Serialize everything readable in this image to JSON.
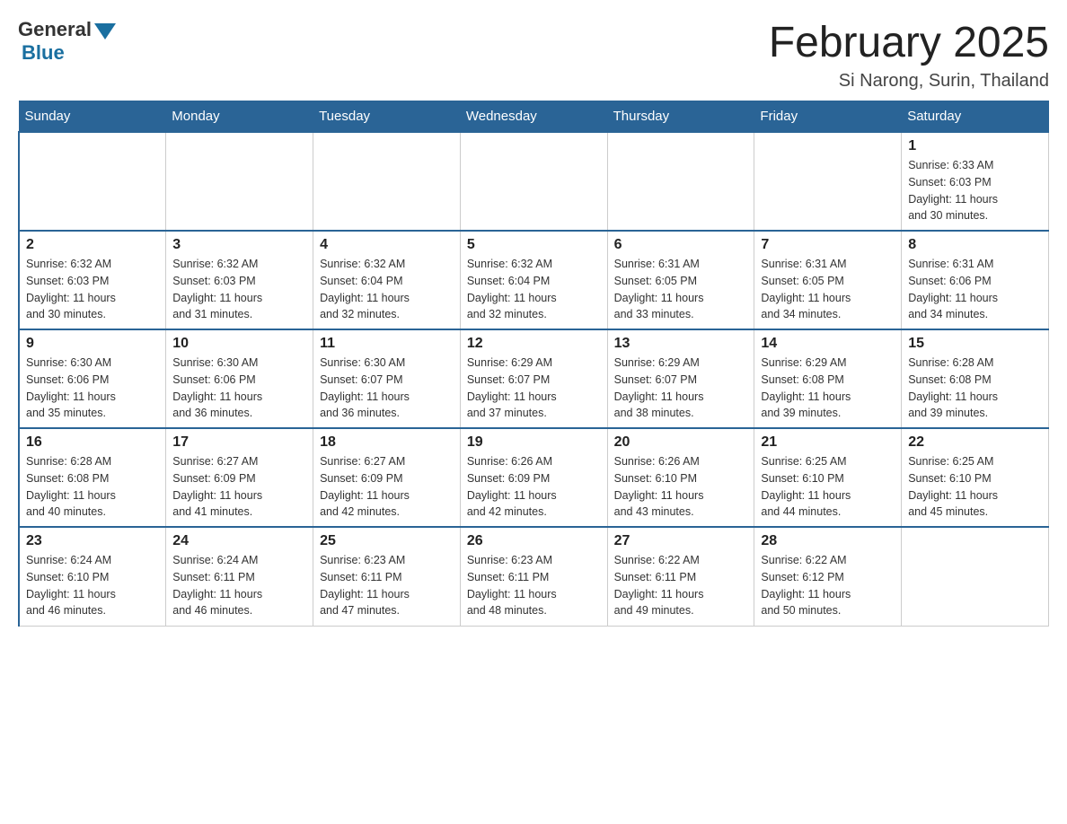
{
  "header": {
    "logo_general": "General",
    "logo_blue": "Blue",
    "month_title": "February 2025",
    "location": "Si Narong, Surin, Thailand"
  },
  "days_of_week": [
    "Sunday",
    "Monday",
    "Tuesday",
    "Wednesday",
    "Thursday",
    "Friday",
    "Saturday"
  ],
  "weeks": [
    [
      {
        "day": "",
        "info": ""
      },
      {
        "day": "",
        "info": ""
      },
      {
        "day": "",
        "info": ""
      },
      {
        "day": "",
        "info": ""
      },
      {
        "day": "",
        "info": ""
      },
      {
        "day": "",
        "info": ""
      },
      {
        "day": "1",
        "info": "Sunrise: 6:33 AM\nSunset: 6:03 PM\nDaylight: 11 hours\nand 30 minutes."
      }
    ],
    [
      {
        "day": "2",
        "info": "Sunrise: 6:32 AM\nSunset: 6:03 PM\nDaylight: 11 hours\nand 30 minutes."
      },
      {
        "day": "3",
        "info": "Sunrise: 6:32 AM\nSunset: 6:03 PM\nDaylight: 11 hours\nand 31 minutes."
      },
      {
        "day": "4",
        "info": "Sunrise: 6:32 AM\nSunset: 6:04 PM\nDaylight: 11 hours\nand 32 minutes."
      },
      {
        "day": "5",
        "info": "Sunrise: 6:32 AM\nSunset: 6:04 PM\nDaylight: 11 hours\nand 32 minutes."
      },
      {
        "day": "6",
        "info": "Sunrise: 6:31 AM\nSunset: 6:05 PM\nDaylight: 11 hours\nand 33 minutes."
      },
      {
        "day": "7",
        "info": "Sunrise: 6:31 AM\nSunset: 6:05 PM\nDaylight: 11 hours\nand 34 minutes."
      },
      {
        "day": "8",
        "info": "Sunrise: 6:31 AM\nSunset: 6:06 PM\nDaylight: 11 hours\nand 34 minutes."
      }
    ],
    [
      {
        "day": "9",
        "info": "Sunrise: 6:30 AM\nSunset: 6:06 PM\nDaylight: 11 hours\nand 35 minutes."
      },
      {
        "day": "10",
        "info": "Sunrise: 6:30 AM\nSunset: 6:06 PM\nDaylight: 11 hours\nand 36 minutes."
      },
      {
        "day": "11",
        "info": "Sunrise: 6:30 AM\nSunset: 6:07 PM\nDaylight: 11 hours\nand 36 minutes."
      },
      {
        "day": "12",
        "info": "Sunrise: 6:29 AM\nSunset: 6:07 PM\nDaylight: 11 hours\nand 37 minutes."
      },
      {
        "day": "13",
        "info": "Sunrise: 6:29 AM\nSunset: 6:07 PM\nDaylight: 11 hours\nand 38 minutes."
      },
      {
        "day": "14",
        "info": "Sunrise: 6:29 AM\nSunset: 6:08 PM\nDaylight: 11 hours\nand 39 minutes."
      },
      {
        "day": "15",
        "info": "Sunrise: 6:28 AM\nSunset: 6:08 PM\nDaylight: 11 hours\nand 39 minutes."
      }
    ],
    [
      {
        "day": "16",
        "info": "Sunrise: 6:28 AM\nSunset: 6:08 PM\nDaylight: 11 hours\nand 40 minutes."
      },
      {
        "day": "17",
        "info": "Sunrise: 6:27 AM\nSunset: 6:09 PM\nDaylight: 11 hours\nand 41 minutes."
      },
      {
        "day": "18",
        "info": "Sunrise: 6:27 AM\nSunset: 6:09 PM\nDaylight: 11 hours\nand 42 minutes."
      },
      {
        "day": "19",
        "info": "Sunrise: 6:26 AM\nSunset: 6:09 PM\nDaylight: 11 hours\nand 42 minutes."
      },
      {
        "day": "20",
        "info": "Sunrise: 6:26 AM\nSunset: 6:10 PM\nDaylight: 11 hours\nand 43 minutes."
      },
      {
        "day": "21",
        "info": "Sunrise: 6:25 AM\nSunset: 6:10 PM\nDaylight: 11 hours\nand 44 minutes."
      },
      {
        "day": "22",
        "info": "Sunrise: 6:25 AM\nSunset: 6:10 PM\nDaylight: 11 hours\nand 45 minutes."
      }
    ],
    [
      {
        "day": "23",
        "info": "Sunrise: 6:24 AM\nSunset: 6:10 PM\nDaylight: 11 hours\nand 46 minutes."
      },
      {
        "day": "24",
        "info": "Sunrise: 6:24 AM\nSunset: 6:11 PM\nDaylight: 11 hours\nand 46 minutes."
      },
      {
        "day": "25",
        "info": "Sunrise: 6:23 AM\nSunset: 6:11 PM\nDaylight: 11 hours\nand 47 minutes."
      },
      {
        "day": "26",
        "info": "Sunrise: 6:23 AM\nSunset: 6:11 PM\nDaylight: 11 hours\nand 48 minutes."
      },
      {
        "day": "27",
        "info": "Sunrise: 6:22 AM\nSunset: 6:11 PM\nDaylight: 11 hours\nand 49 minutes."
      },
      {
        "day": "28",
        "info": "Sunrise: 6:22 AM\nSunset: 6:12 PM\nDaylight: 11 hours\nand 50 minutes."
      },
      {
        "day": "",
        "info": ""
      }
    ]
  ]
}
